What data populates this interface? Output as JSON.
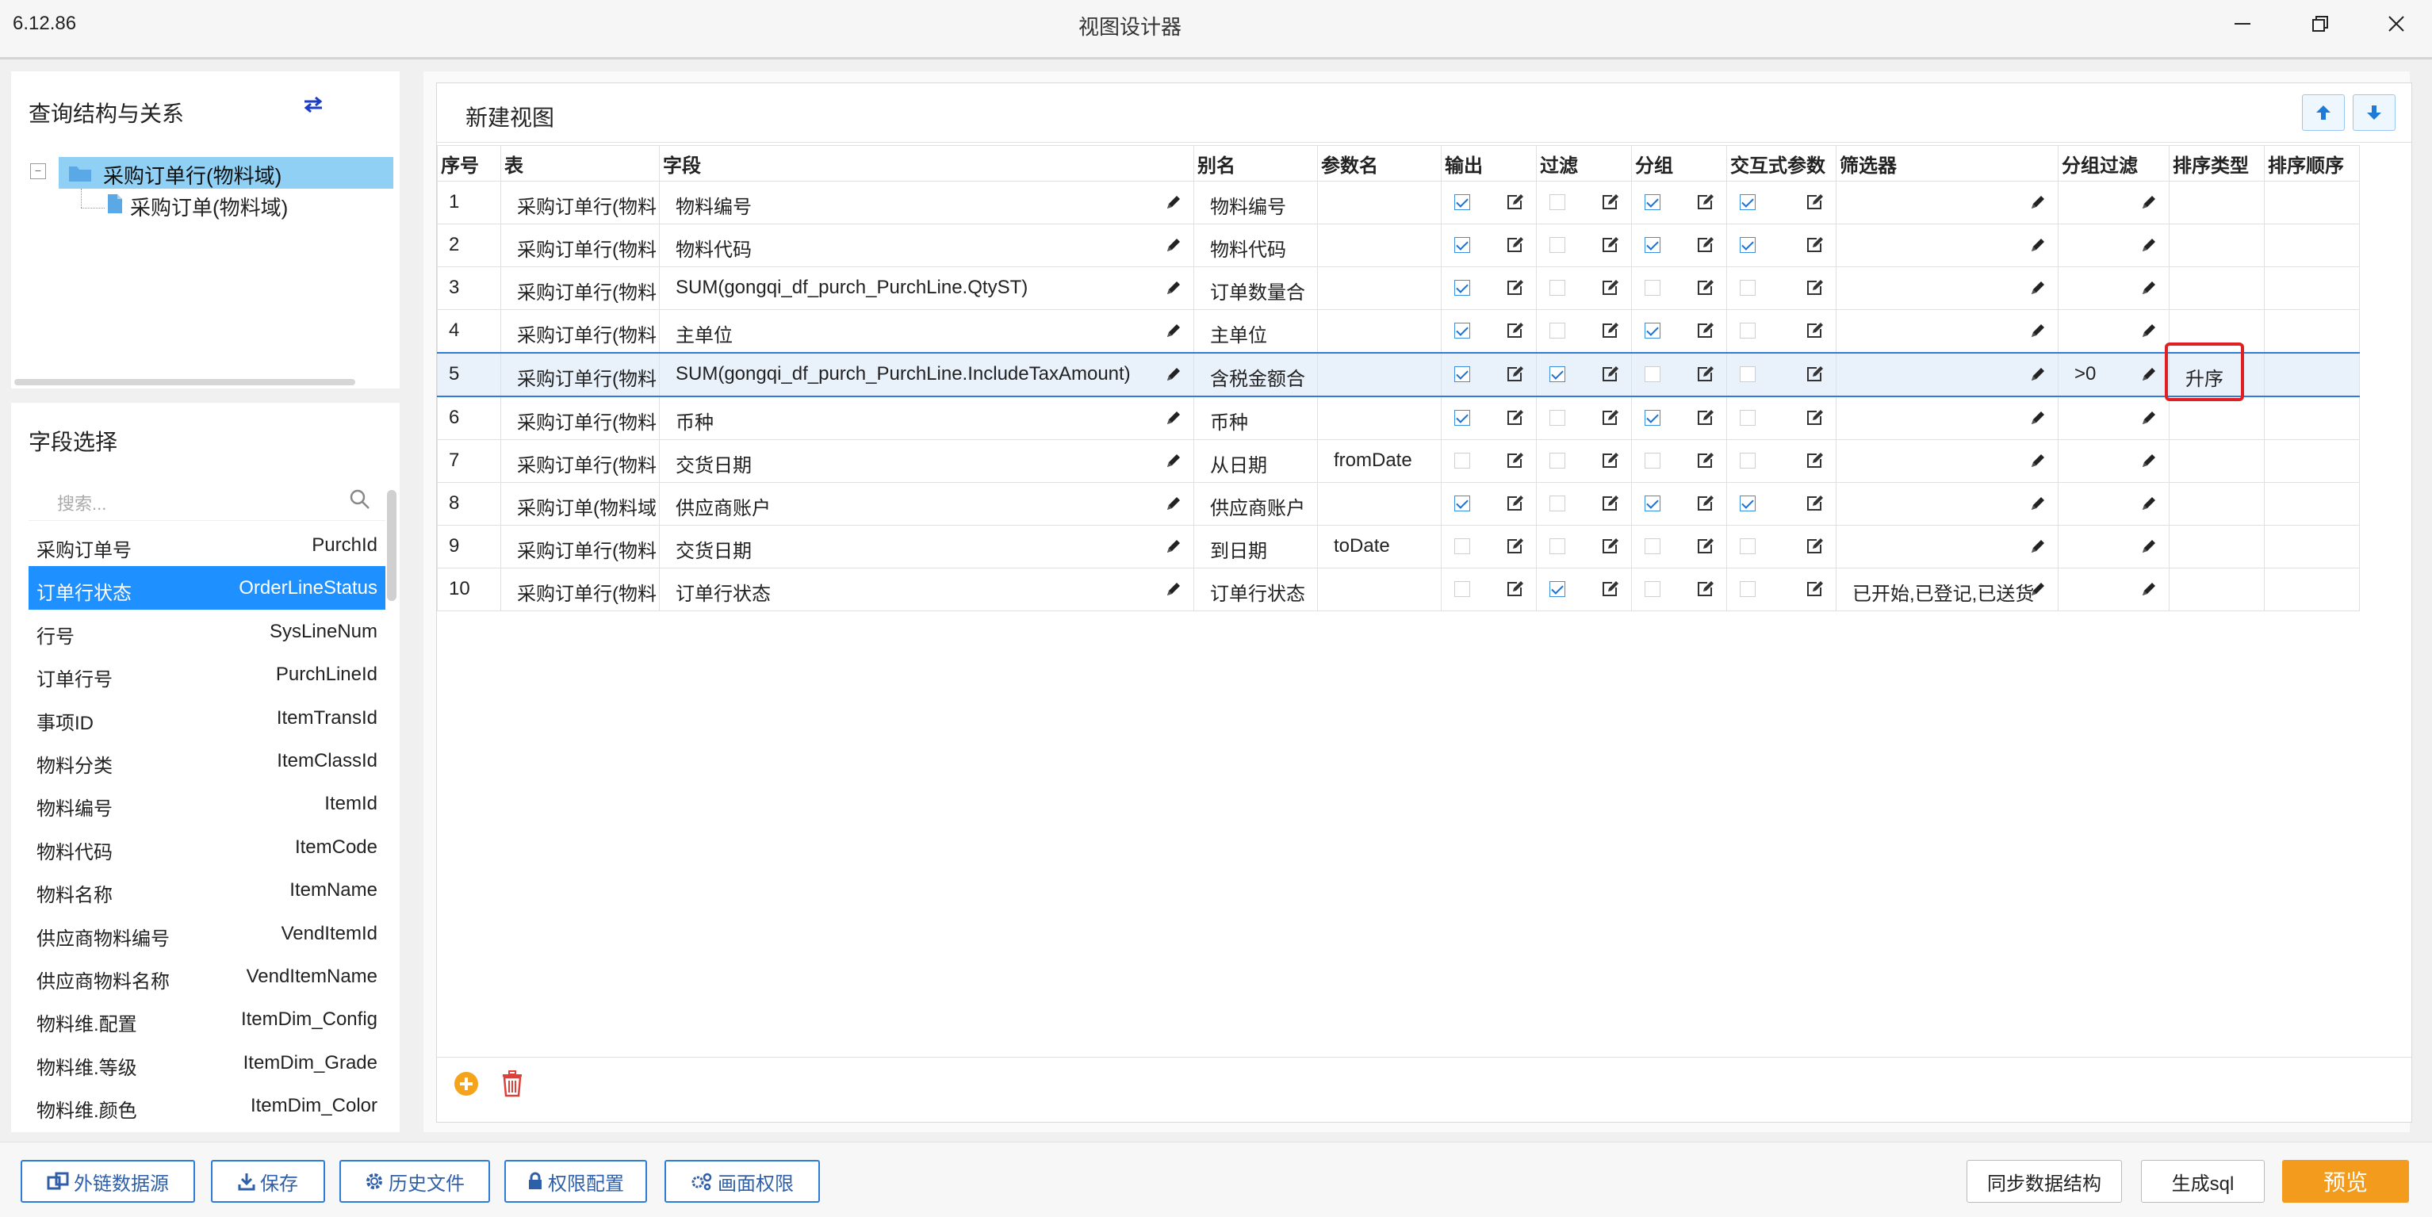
{
  "window": {
    "version": "6.12.86",
    "title": "视图设计器"
  },
  "left_top": {
    "title": "查询结构与关系",
    "tree_root": "采购订单行(物料域)",
    "tree_child": "采购订单(物料域)"
  },
  "left_bottom": {
    "title": "字段选择",
    "search_placeholder": "搜索...",
    "fields": [
      {
        "label": "采购订单号",
        "name": "PurchId"
      },
      {
        "label": "订单行状态",
        "name": "OrderLineStatus"
      },
      {
        "label": "行号",
        "name": "SysLineNum"
      },
      {
        "label": "订单行号",
        "name": "PurchLineId"
      },
      {
        "label": "事项ID",
        "name": "ItemTransId"
      },
      {
        "label": "物料分类",
        "name": "ItemClassId"
      },
      {
        "label": "物料编号",
        "name": "ItemId"
      },
      {
        "label": "物料代码",
        "name": "ItemCode"
      },
      {
        "label": "物料名称",
        "name": "ItemName"
      },
      {
        "label": "供应商物料编号",
        "name": "VendItemId"
      },
      {
        "label": "供应商物料名称",
        "name": "VendItemName"
      },
      {
        "label": "物料维.配置",
        "name": "ItemDim_Config"
      },
      {
        "label": "物料维.等级",
        "name": "ItemDim_Grade"
      },
      {
        "label": "物料维.颜色",
        "name": "ItemDim_Color"
      }
    ]
  },
  "grid": {
    "title": "新建视图",
    "columns": [
      "序号",
      "表",
      "字段",
      "别名",
      "参数名",
      "输出",
      "过滤",
      "分组",
      "交互式参数",
      "筛选器",
      "分组过滤",
      "排序类型",
      "排序顺序"
    ],
    "rows": [
      {
        "no": "1",
        "table": "采购订单行(物料",
        "field": "物料编号",
        "alias": "物料编号",
        "param": "",
        "out": true,
        "filter": false,
        "group": true,
        "inter": true,
        "filterer": "",
        "gfilter": "",
        "sort": "",
        "order": ""
      },
      {
        "no": "2",
        "table": "采购订单行(物料",
        "field": "物料代码",
        "alias": "物料代码",
        "param": "",
        "out": true,
        "filter": false,
        "group": true,
        "inter": true,
        "filterer": "",
        "gfilter": "",
        "sort": "",
        "order": ""
      },
      {
        "no": "3",
        "table": "采购订单行(物料",
        "field": "SUM(gongqi_df_purch_PurchLine.QtyST)",
        "alias": "订单数量合",
        "param": "",
        "out": true,
        "filter": false,
        "group": false,
        "inter": false,
        "filterer": "",
        "gfilter": "",
        "sort": "",
        "order": ""
      },
      {
        "no": "4",
        "table": "采购订单行(物料",
        "field": "主单位",
        "alias": "主单位",
        "param": "",
        "out": true,
        "filter": false,
        "group": true,
        "inter": false,
        "filterer": "",
        "gfilter": "",
        "sort": "",
        "order": ""
      },
      {
        "no": "5",
        "table": "采购订单行(物料",
        "field": "SUM(gongqi_df_purch_PurchLine.IncludeTaxAmount)",
        "alias": "含税金额合",
        "param": "",
        "out": true,
        "filter": true,
        "group": false,
        "inter": false,
        "filterer": "",
        "gfilter": ">0",
        "sort": "升序",
        "order": ""
      },
      {
        "no": "6",
        "table": "采购订单行(物料",
        "field": "币种",
        "alias": "币种",
        "param": "",
        "out": true,
        "filter": false,
        "group": true,
        "inter": false,
        "filterer": "",
        "gfilter": "",
        "sort": "",
        "order": ""
      },
      {
        "no": "7",
        "table": "采购订单行(物料",
        "field": "交货日期",
        "alias": "从日期",
        "param": "fromDate",
        "out": false,
        "filter": false,
        "group": false,
        "inter": false,
        "filterer": "",
        "gfilter": "",
        "sort": "",
        "order": ""
      },
      {
        "no": "8",
        "table": "采购订单(物料域",
        "field": "供应商账户",
        "alias": "供应商账户",
        "param": "",
        "out": true,
        "filter": false,
        "group": true,
        "inter": true,
        "filterer": "",
        "gfilter": "",
        "sort": "",
        "order": ""
      },
      {
        "no": "9",
        "table": "采购订单行(物料",
        "field": "交货日期",
        "alias": "到日期",
        "param": "toDate",
        "out": false,
        "filter": false,
        "group": false,
        "inter": false,
        "filterer": "",
        "gfilter": "",
        "sort": "",
        "order": ""
      },
      {
        "no": "10",
        "table": "采购订单行(物料",
        "field": "订单行状态",
        "alias": "订单行状态",
        "param": "",
        "out": false,
        "filter": true,
        "group": false,
        "inter": false,
        "filterer": "已开始,已登记,已送货",
        "gfilter": "",
        "sort": "",
        "order": ""
      }
    ]
  },
  "footer": {
    "ext_source": "外链数据源",
    "save": "保存",
    "history": "历史文件",
    "perm_config": "权限配置",
    "screen_perm": "画面权限",
    "sync": "同步数据结构",
    "gen_sql": "生成sql",
    "preview": "预览"
  },
  "colors": {
    "accent": "#1e90ff",
    "tree_highlight": "#8fd0f4",
    "preview": "#f29b1c",
    "highlight_box": "#e02020"
  }
}
